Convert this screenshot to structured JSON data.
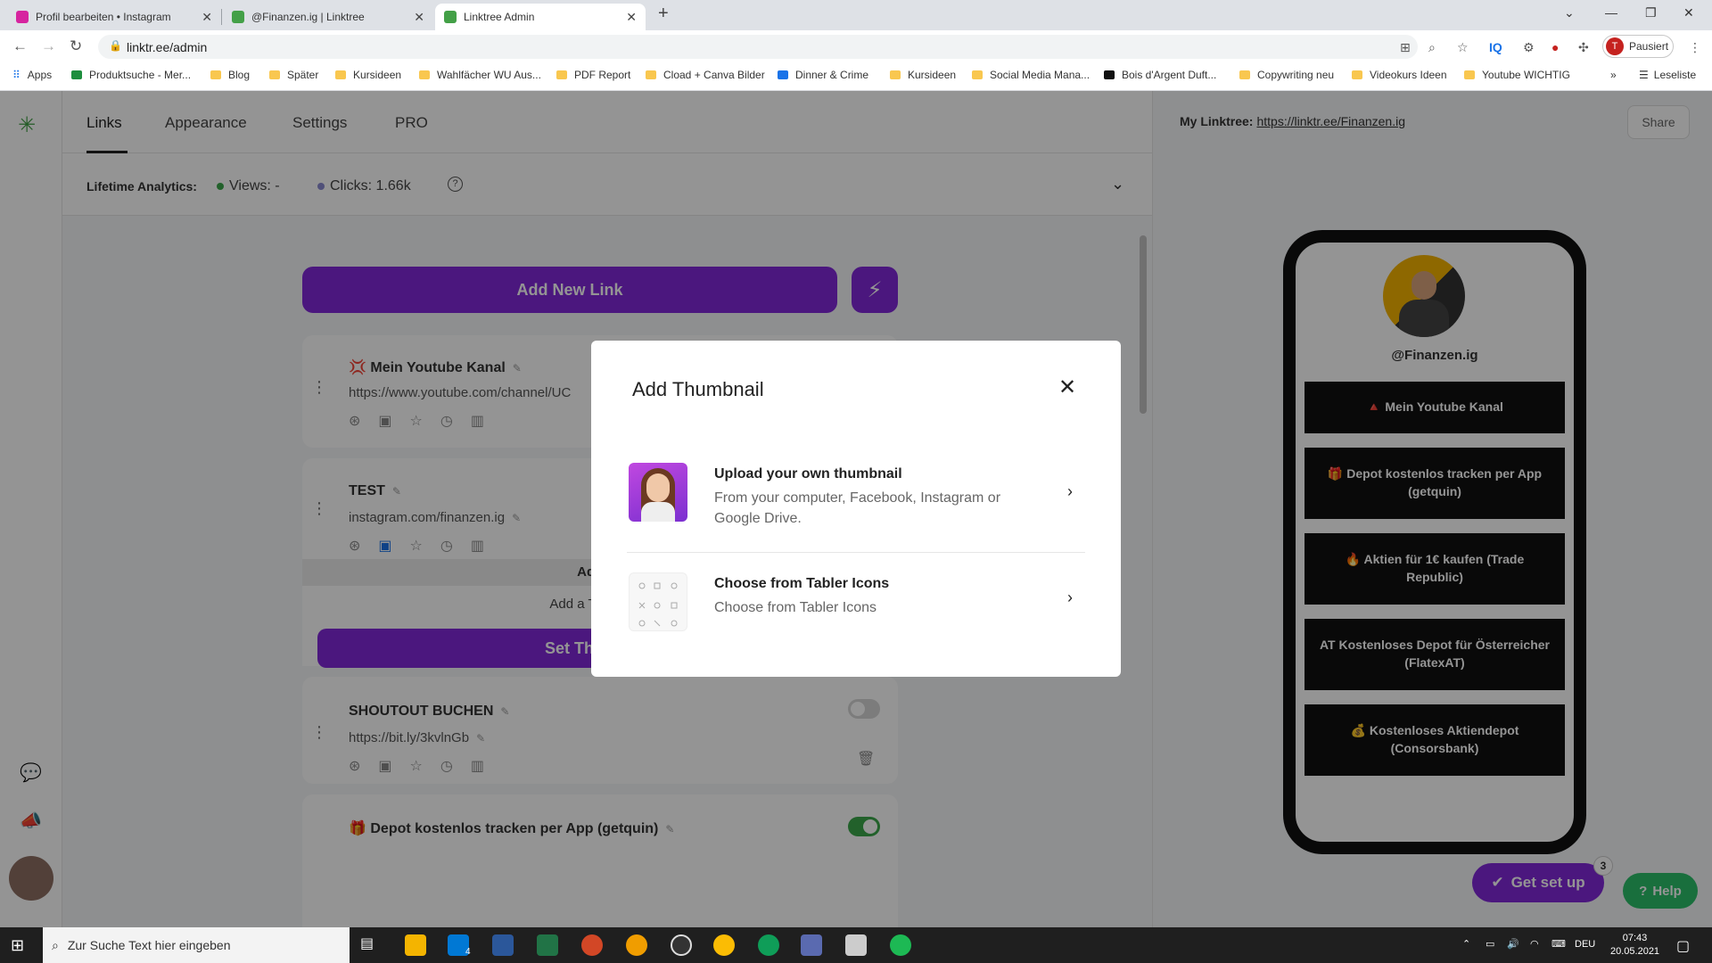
{
  "browser": {
    "tabs": [
      {
        "label": "Profil bearbeiten • Instagram",
        "color": "#d6249f"
      },
      {
        "label": "@Finanzen.ig | Linktree",
        "color": "#43a047"
      },
      {
        "label": "Linktree Admin",
        "color": "#43a047"
      }
    ],
    "new_tab": "+",
    "url": "linktr.ee/admin",
    "profile_initial": "T",
    "profile_label": "Pausiert",
    "bookmarks": [
      "Apps",
      "Produktsuche - Mer...",
      "Blog",
      "Später",
      "Kursideen",
      "Wahlfächer WU Aus...",
      "PDF Report",
      "Cload + Canva Bilder",
      "Dinner & Crime",
      "Kursideen",
      "Social Media Mana...",
      "Bois d'Argent Duft...",
      "Copywriting neu",
      "Videokurs Ideen",
      "Youtube WICHTIG"
    ],
    "bookmarks_more": "»",
    "reading_list": "Leseliste"
  },
  "app": {
    "nav_tabs": [
      "Links",
      "Appearance",
      "Settings",
      "PRO"
    ],
    "analytics": {
      "label": "Lifetime Analytics:",
      "views": "Views: -",
      "clicks": "Clicks: 1.66k",
      "views_color": "#3ca84a",
      "clicks_color": "#8a8ad0"
    },
    "add_link": "Add New Link",
    "links": [
      {
        "title": "💢 Mein Youtube Kanal",
        "url": "https://www.youtube.com/channel/UC"
      },
      {
        "title": "TEST",
        "url": "instagram.com/finanzen.ig"
      },
      {
        "title": "SHOUTOUT BUCHEN",
        "url": "https://bit.ly/3kvlnGb"
      },
      {
        "title": "🎁 Depot kostenlos tracken per App (getquin)",
        "url": ""
      }
    ],
    "thumbnail_panel": {
      "header": "Add Th",
      "text": "Add a Thumbnail",
      "button": "Set Thumbnail"
    },
    "accent": "#8129d9"
  },
  "preview": {
    "label": "My Linktree:",
    "link": "https://linktr.ee/Finanzen.ig",
    "share": "Share",
    "handle": "@Finanzen.ig",
    "links": [
      "🔺 Mein Youtube Kanal",
      "🎁 Depot kostenlos tracken per App (getquin)",
      "🔥 Aktien für 1€ kaufen (Trade Republic)",
      "AT Kostenloses Depot für Österreicher (FlatexAT)",
      "💰 Kostenloses Aktiendepot (Consorsbank)"
    ],
    "get_set_up": "Get set up",
    "badge": "3",
    "help": "Help"
  },
  "modal": {
    "title": "Add Thumbnail",
    "options": [
      {
        "title": "Upload your own thumbnail",
        "desc": "From your computer, Facebook, Instagram or Google Drive."
      },
      {
        "title": "Choose from Tabler Icons",
        "desc": "Choose from Tabler Icons"
      }
    ]
  },
  "taskbar": {
    "search_placeholder": "Zur Suche Text hier eingeben",
    "mail_badge": "4",
    "lang": "DEU",
    "time": "07:43",
    "date": "20.05.2021"
  }
}
